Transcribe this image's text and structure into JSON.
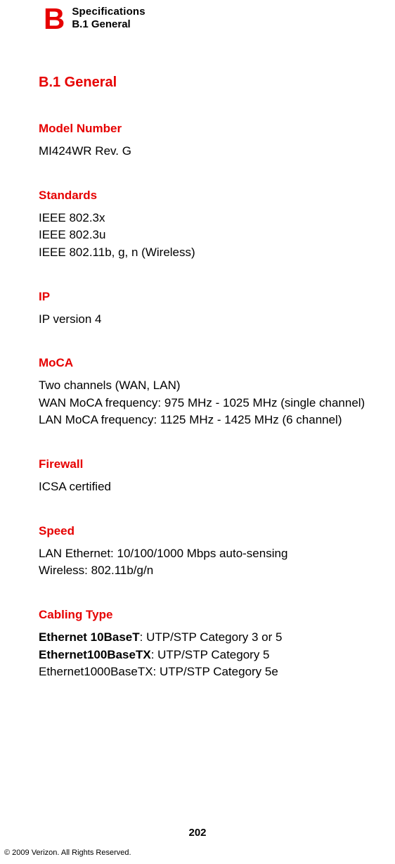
{
  "header": {
    "letter": "B",
    "title": "Specifications",
    "subtitle": "B.1  General"
  },
  "main": {
    "title": "B.1  General",
    "sections": {
      "model_number": {
        "heading": "Model Number",
        "body": "MI424WR  Rev. G"
      },
      "standards": {
        "heading": "Standards",
        "lines": [
          "IEEE 802.3x",
          "IEEE 802.3u",
          "IEEE 802.11b, g, n (Wireless)"
        ]
      },
      "ip": {
        "heading": "IP",
        "body": "IP version 4"
      },
      "moca": {
        "heading": "MoCA",
        "lines": [
          "Two channels (WAN, LAN)",
          "WAN MoCA frequency: 975 MHz - 1025 MHz (single channel)",
          "LAN MoCA frequency: 1125 MHz - 1425 MHz (6 channel)"
        ]
      },
      "firewall": {
        "heading": "Firewall",
        "body": "ICSA certified"
      },
      "speed": {
        "heading": "Speed",
        "lines": [
          "LAN Ethernet: 10/100/1000 Mbps auto-sensing",
          "Wireless: 802.11b/g/n"
        ]
      },
      "cabling": {
        "heading": "Cabling Type",
        "items": [
          {
            "bold": "Ethernet 10BaseT",
            "rest": ": UTP/STP Category 3 or 5"
          },
          {
            "bold": "Ethernet100BaseTX",
            "rest": ": UTP/STP Category 5"
          },
          {
            "bold": "",
            "rest": "Ethernet1000BaseTX: UTP/STP Category 5e"
          }
        ]
      }
    }
  },
  "page_number": "202",
  "footer": "© 2009 Verizon. All Rights Reserved."
}
